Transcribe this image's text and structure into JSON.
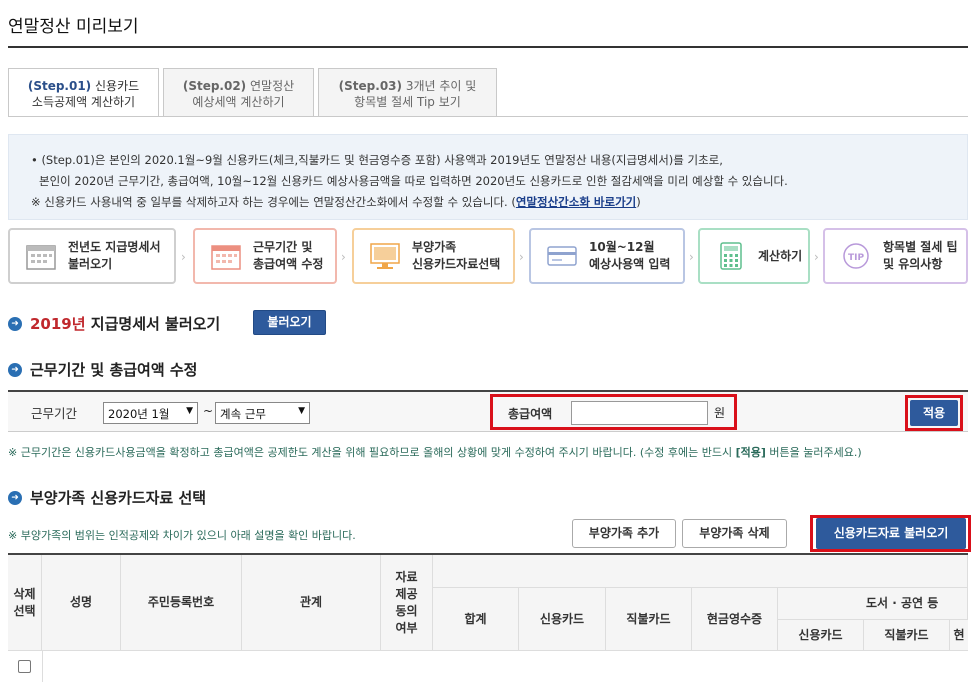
{
  "page": {
    "title": "연말정산 미리보기"
  },
  "tabs": [
    {
      "step": "(Step.01)",
      "line1": "신용카드",
      "line2": "소득공제액 계산하기",
      "active": true
    },
    {
      "step": "(Step.02)",
      "line1": "연말정산",
      "line2": "예상세액 계산하기",
      "active": false
    },
    {
      "step": "(Step.03)",
      "line1": "3개년 추이 및",
      "line2": "항목별 절세 Tip 보기",
      "active": false
    }
  ],
  "info": {
    "line1": "• (Step.01)은 본인의 2020.1월~9월 신용카드(체크,직불카드 및 현금영수증 포함) 사용액과 2019년도 연말정산 내용(지급명세서)를 기초로,",
    "line2": "본인이 2020년 근무기간, 총급여액, 10월~12월 신용카드 예상사용금액을 따로 입력하면 2020년도 신용카드로 인한 절감세액을 미리 예상할 수 있습니다.",
    "line3_pre": "※ 신용카드 사용내역 중 일부를 삭제하고자 하는 경우에는 연말정산간소화에서 수정할 수 있습니다. (",
    "line3_link": "연말정산간소화 바로가기",
    "line3_post": ")"
  },
  "steps": [
    {
      "line1": "전년도 지급명세서",
      "line2": "불러오기",
      "icon": "calendar-icon",
      "color": "#bbbbbb"
    },
    {
      "line1": "근무기간 및",
      "line2": "총급여액 수정",
      "icon": "calendar-grid-icon",
      "color": "#f2b8ad"
    },
    {
      "line1": "부양가족",
      "line2": "신용카드자료선택",
      "icon": "monitor-icon",
      "color": "#f6cf9a"
    },
    {
      "line1": "10월~12월",
      "line2": "예상사용액 입력",
      "icon": "card-icon",
      "color": "#b9c6e3"
    },
    {
      "line1": "계산하기",
      "line2": "",
      "icon": "calculator-icon",
      "color": "#a9dfc4"
    },
    {
      "line1": "항목별 절세 팁",
      "line2": "및 유의사항",
      "icon": "tip-icon",
      "color": "#d5c0e8"
    }
  ],
  "section1": {
    "year": "2019년",
    "title": "지급명세서 불러오기",
    "button": "불러오기"
  },
  "section2": {
    "title": "근무기간 및 총급여액 수정",
    "period_label": "근무기간",
    "start_value": "2020년 1월",
    "tilde": "~",
    "end_value": "계속 근무",
    "amount_label": "총급여액",
    "amount_value": "",
    "unit": "원",
    "apply": "적용",
    "note_pre": "※ 근무기간은 신용카드사용금액을 확정하고 총급여액은 공제한도 계산을 위해 필요하므로 올해의 상황에 맞게 수정하여 주시기 바랍니다. (수정 후에는 반드시 ",
    "note_bold": "[적용]",
    "note_post": " 버튼을 눌러주세요.)"
  },
  "section3": {
    "title": "부양가족 신용카드자료 선택",
    "note": "※ 부양가족의 범위는 인적공제와 차이가 있으니 아래 설명을 확인 바랍니다.",
    "add": "부양가족 추가",
    "delete": "부양가족 삭제",
    "load": "신용카드자료 불러오기"
  },
  "table": {
    "headers": {
      "select": "삭제\n선택",
      "name": "성명",
      "rrn": "주민등록번호",
      "relation": "관계",
      "consent": "자료\n제공\n동의\n여부",
      "total": "합계",
      "credit": "신용카드",
      "debit": "직불카드",
      "cash": "현금영수증",
      "culture": "도서 · 공연 등",
      "culture_credit": "신용카드",
      "culture_debit": "직불카드",
      "culture_cash": "현"
    }
  }
}
